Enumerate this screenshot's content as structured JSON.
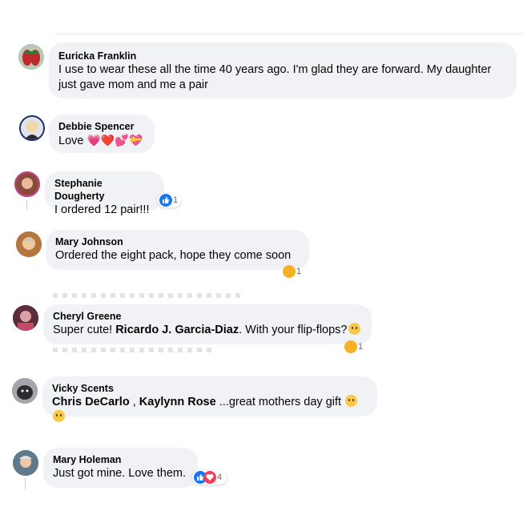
{
  "comments": [
    {
      "name": "Euricka Franklin",
      "text": "I use to wear these all the time 40 years ago. I'm glad they are forward. My daughter just gave mom and me a pair"
    },
    {
      "name": "Debbie Spencer",
      "text": "Love",
      "emoji": "💗❤️💕💝"
    },
    {
      "name": "Stephanie Dougherty",
      "text": "I ordered 12 pair!!!",
      "reaction_count": "1"
    },
    {
      "name": "Mary Johnson",
      "text": "Ordered the eight pack, hope they come soon",
      "reaction_count": "1"
    },
    {
      "name": "Cheryl Greene",
      "text_before": "Super cute! ",
      "mention": "Ricardo J. Garcia-Diaz",
      "text_after": ". With your flip-flops?",
      "reaction_count": "1"
    },
    {
      "name": "Vicky Scents",
      "mention1": "Chris DeCarlo",
      "separator": " , ",
      "mention2": "Kaylynn Rose",
      "text_after": " ...great mothers day gift"
    },
    {
      "name": "Mary Holeman",
      "text": "Just got mine. Love them.",
      "reaction_count": "4"
    }
  ],
  "colors": {
    "bubble": "#f0f2f5",
    "like": "#1877f2",
    "love": "#f33e58",
    "haha": "#f7b125"
  }
}
